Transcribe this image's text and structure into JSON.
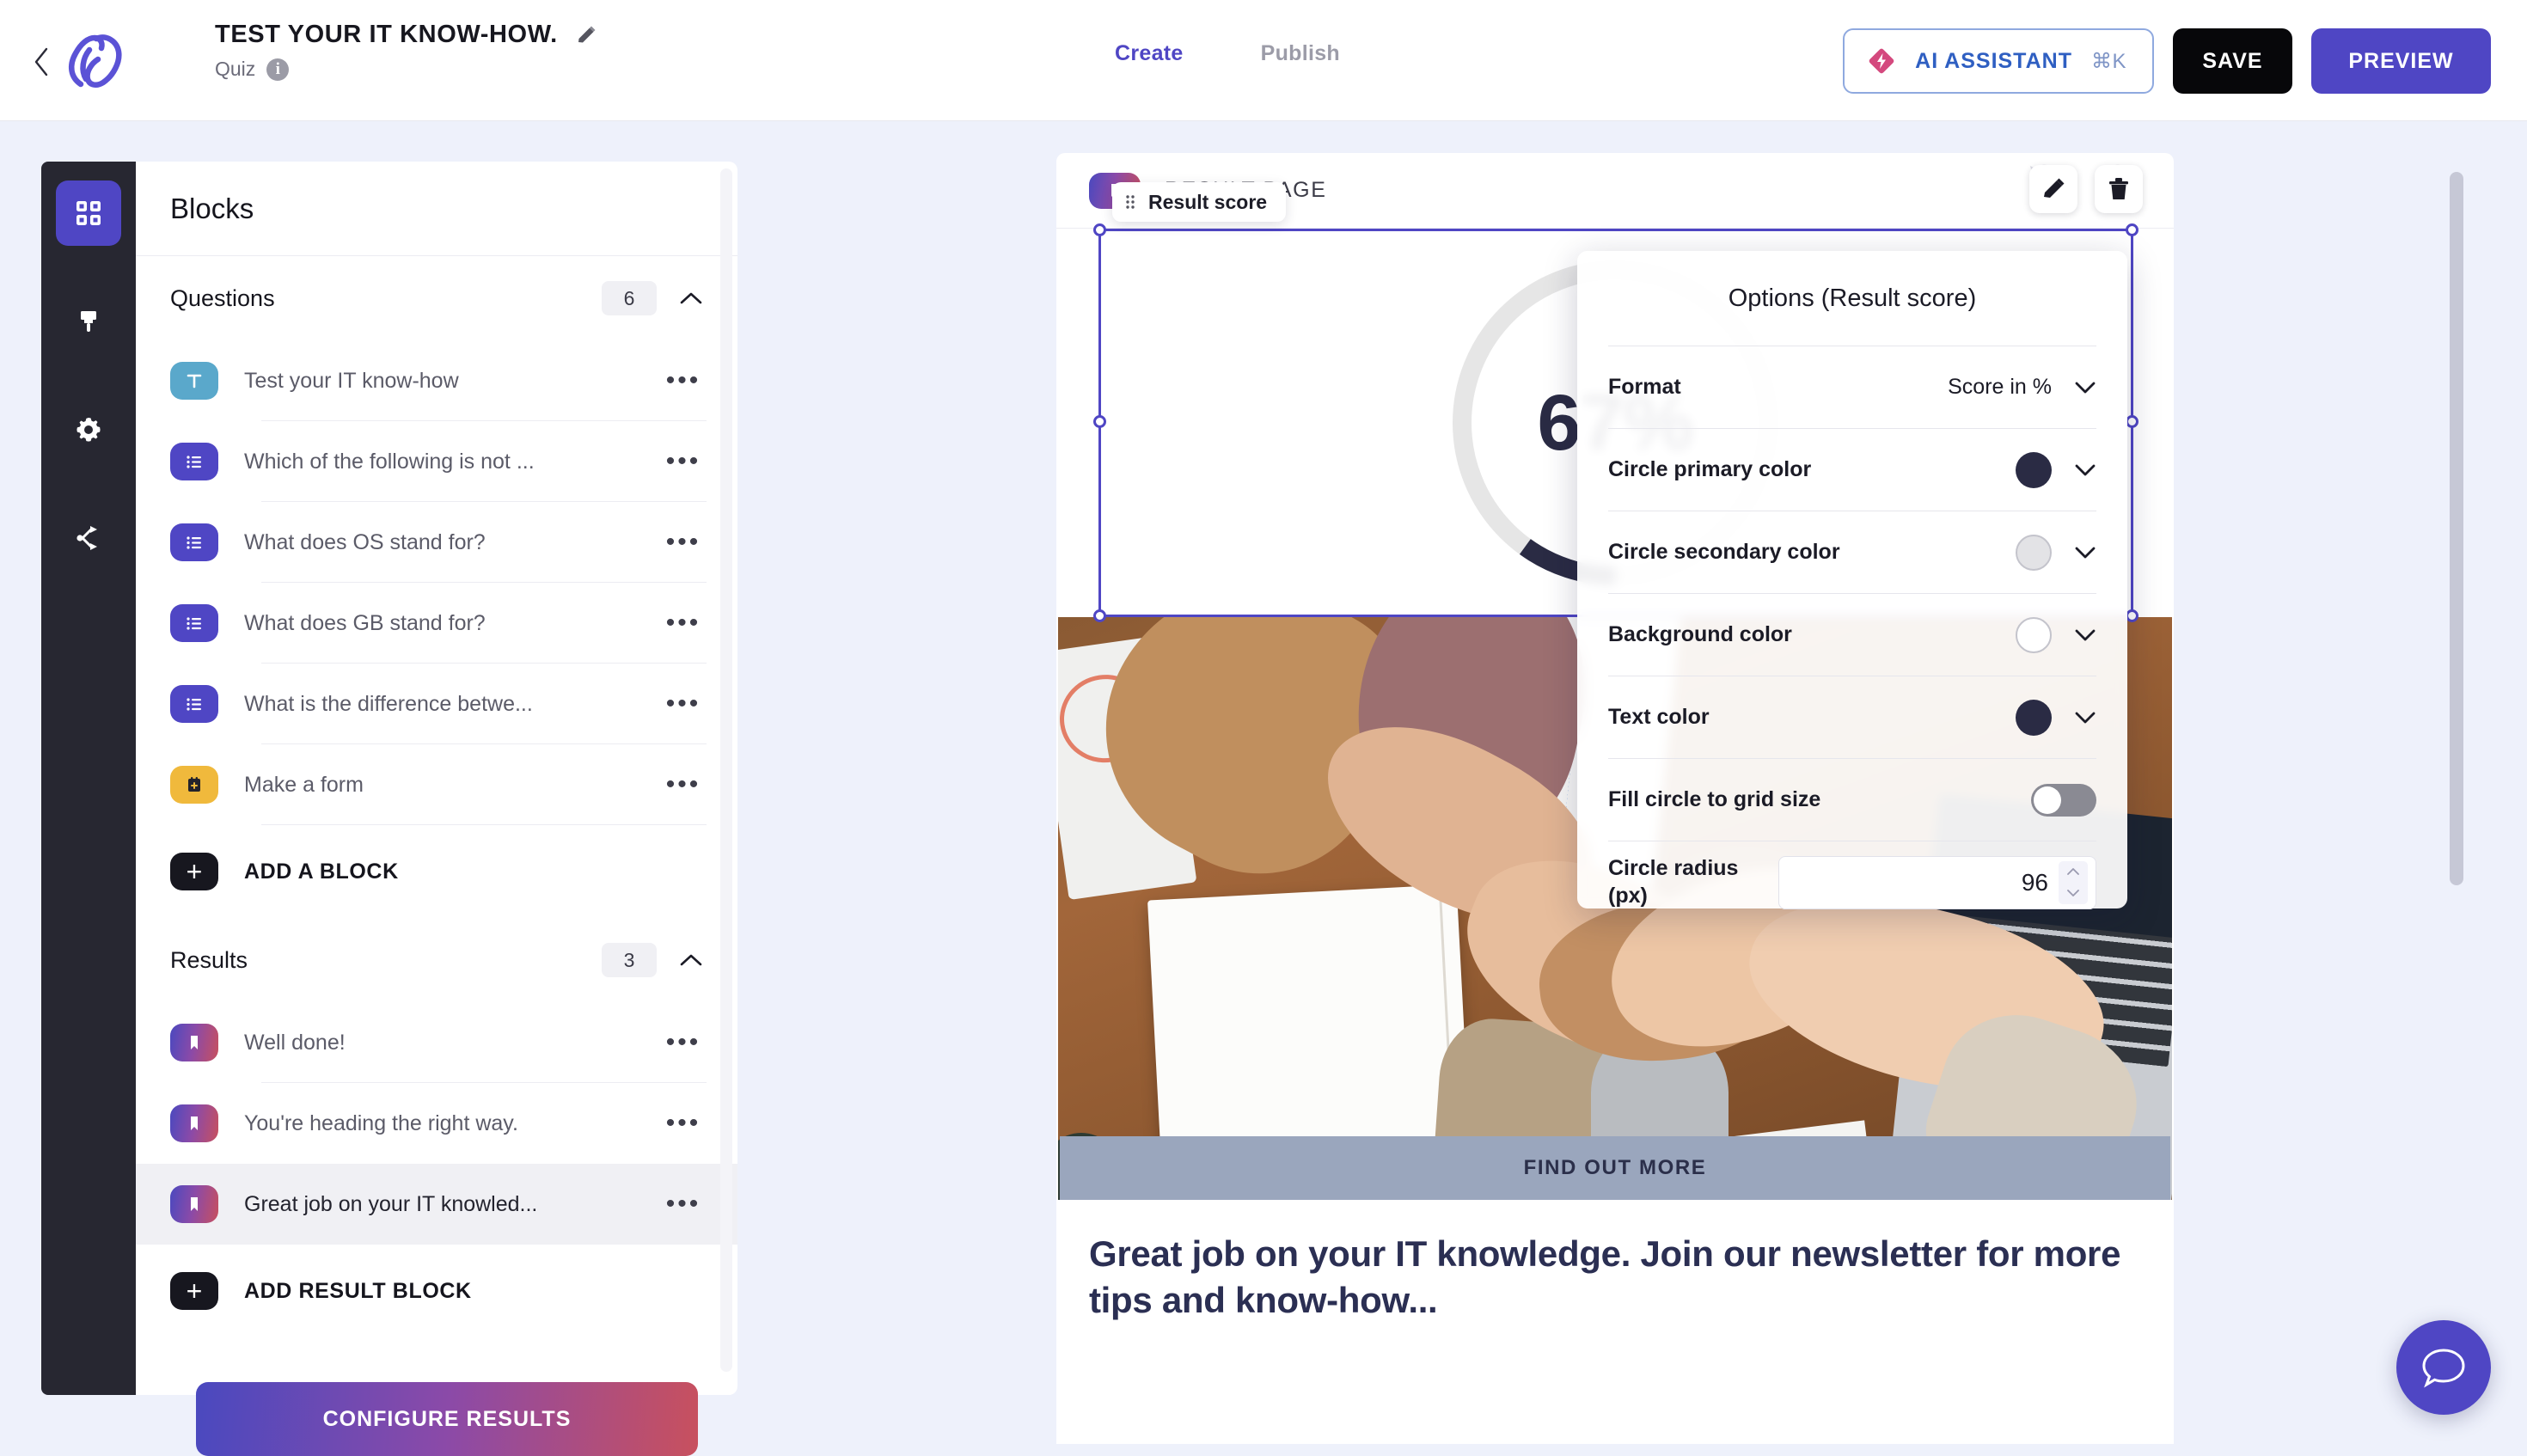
{
  "header": {
    "back_icon": "chevron-left-icon",
    "logo_icon": "brand-logo-icon",
    "title": "TEST YOUR IT KNOW-HOW.",
    "title_edit_icon": "pencil-icon",
    "subtitle": "Quiz",
    "info_icon": "info-icon",
    "info_glyph": "i",
    "tabs": [
      {
        "label": "Create",
        "active": true
      },
      {
        "label": "Publish",
        "active": false
      }
    ],
    "ai_button": {
      "icon": "ai-diamond-icon",
      "label": "AI ASSISTANT",
      "shortcut": "⌘K"
    },
    "save_label": "SAVE",
    "preview_label": "PREVIEW"
  },
  "rail": {
    "items": [
      {
        "name": "blocks",
        "icon": "grid-icon",
        "active": true
      },
      {
        "name": "design",
        "icon": "paintbrush-icon",
        "active": false
      },
      {
        "name": "settings",
        "icon": "gear-icon",
        "active": false
      },
      {
        "name": "logic",
        "icon": "share-branch-icon",
        "active": false
      }
    ]
  },
  "blocks_panel": {
    "title": "Blocks",
    "questions_section": {
      "label": "Questions",
      "count": "6",
      "caret_icon": "chevron-up-icon",
      "items": [
        {
          "label": "Test your IT know-how",
          "icon": "text-block-icon",
          "type": "text",
          "selected": false,
          "menu_icon": "ellipsis-icon"
        },
        {
          "label": "Which of the following is not ...",
          "icon": "choice-block-icon",
          "type": "choice",
          "selected": false,
          "menu_icon": "ellipsis-icon"
        },
        {
          "label": "What does OS stand for?",
          "icon": "choice-block-icon",
          "type": "choice",
          "selected": false,
          "menu_icon": "ellipsis-icon"
        },
        {
          "label": "What does GB stand for?",
          "icon": "choice-block-icon",
          "type": "choice",
          "selected": false,
          "menu_icon": "ellipsis-icon"
        },
        {
          "label": "What is the difference betwe...",
          "icon": "choice-block-icon",
          "type": "choice",
          "selected": false,
          "menu_icon": "ellipsis-icon"
        },
        {
          "label": "Make a form",
          "icon": "form-block-icon",
          "type": "form",
          "selected": false,
          "menu_icon": "ellipsis-icon"
        }
      ],
      "add_label": "ADD A BLOCK",
      "add_icon": "plus-icon"
    },
    "results_section": {
      "label": "Results",
      "count": "3",
      "caret_icon": "chevron-up-icon",
      "items": [
        {
          "label": "Well done!",
          "icon": "result-block-icon",
          "type": "result",
          "selected": false,
          "menu_icon": "ellipsis-icon"
        },
        {
          "label": "You're heading the right way.",
          "icon": "result-block-icon",
          "type": "result",
          "selected": false,
          "menu_icon": "ellipsis-icon"
        },
        {
          "label": "Great job on your IT knowled...",
          "icon": "result-block-icon",
          "type": "result",
          "selected": true,
          "menu_icon": "ellipsis-icon"
        }
      ],
      "add_label": "ADD RESULT BLOCK",
      "add_icon": "plus-icon"
    },
    "configure_label": "CONFIGURE RESULTS"
  },
  "canvas": {
    "page_icon": "result-page-icon",
    "page_label": "RESULT PAGE",
    "undo_icon": "undo-icon",
    "redo_icon": "redo-icon",
    "edit_icon": "pencil-icon",
    "delete_icon": "trash-icon",
    "block_chip": {
      "grip_icon": "drag-grip-icon",
      "label": "Result score"
    },
    "score_value": "67%",
    "score_percent": 67,
    "ring_primary_color": "#2a2b44",
    "ring_secondary_color": "#e6e6e6",
    "find_out_more_label": "FIND OUT MORE",
    "result_text": "Great job on your IT knowledge. Join our newsletter for more tips and know-how..."
  },
  "options_panel": {
    "title": "Options (Result score)",
    "rows": [
      {
        "label": "Format",
        "kind": "select",
        "value": "Score in %",
        "chevron_icon": "chevron-down-icon"
      },
      {
        "label": "Circle primary color",
        "kind": "color",
        "color": "#2a2b44",
        "chevron_icon": "chevron-down-icon"
      },
      {
        "label": "Circle secondary color",
        "kind": "color",
        "color": "#e3e3e6",
        "chevron_icon": "chevron-down-icon"
      },
      {
        "label": "Background color",
        "kind": "color",
        "color": "#ffffff",
        "chevron_icon": "chevron-down-icon"
      },
      {
        "label": "Text color",
        "kind": "color",
        "color": "#2a2b44",
        "chevron_icon": "chevron-down-icon"
      },
      {
        "label": "Fill circle to grid size",
        "kind": "toggle",
        "value": "off"
      },
      {
        "label": "Circle radius (px)",
        "kind": "number",
        "value": "96",
        "up_icon": "chevron-up-icon",
        "down_icon": "chevron-down-icon"
      }
    ]
  },
  "chat": {
    "icon": "chat-bubble-icon"
  }
}
